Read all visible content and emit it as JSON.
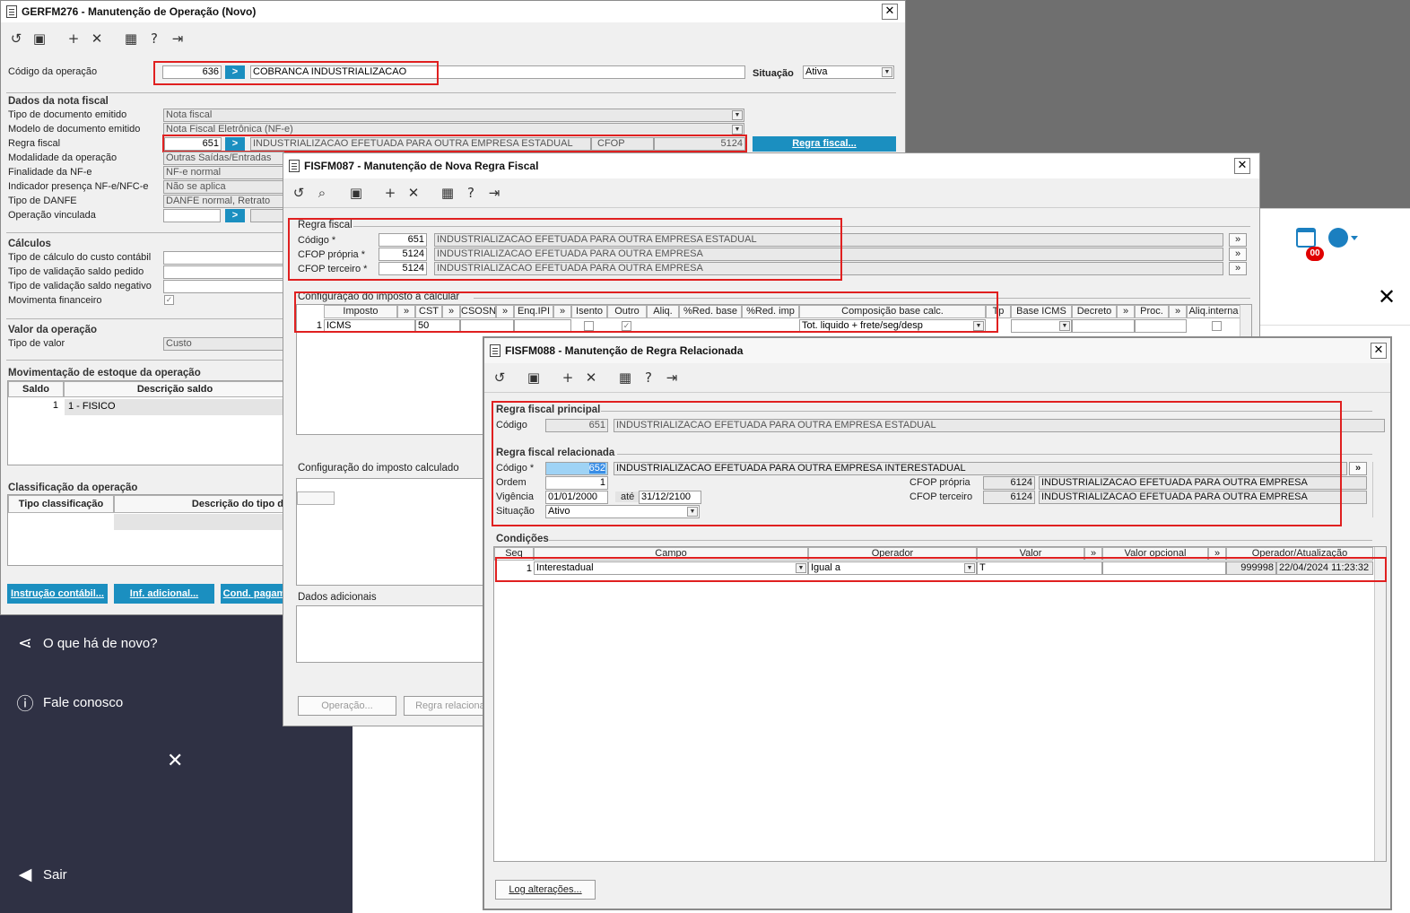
{
  "desktop": {
    "calendar_badge": "00"
  },
  "w1": {
    "title": "GERFM276 - Manutenção de Operação (Novo)",
    "codigo_label": "Código da operação",
    "codigo": "636",
    "descricao": "COBRANCA INDUSTRIALIZACAO",
    "situacao_label": "Situação",
    "situacao": "Ativa",
    "dados_label": "Dados da nota fiscal",
    "rows": [
      {
        "label": "Tipo de documento emitido",
        "value": "Nota fiscal"
      },
      {
        "label": "Modelo de documento emitido",
        "value": "Nota Fiscal Eletrônica (NF-e)"
      },
      {
        "label": "Regra fiscal",
        "value": ""
      },
      {
        "label": "Modalidade da operação",
        "value": "Outras Saídas/Entradas"
      },
      {
        "label": "Finalidade da NF-e",
        "value": "NF-e normal"
      },
      {
        "label": "Indicador presença NF-e/NFC-e",
        "value": "Não se aplica"
      },
      {
        "label": "Tipo de DANFE",
        "value": "DANFE normal, Retrato"
      },
      {
        "label": "Operação vinculada",
        "value": ""
      }
    ],
    "regra_codigo": "651",
    "regra_desc": "INDUSTRIALIZACAO EFETUADA PARA OUTRA EMPRESA ESTADUAL",
    "cfop_label": "CFOP",
    "cfop": "5124",
    "regra_btn": "Regra fiscal...",
    "calculos_label": "Cálculos",
    "calc_rows": [
      "Tipo de cálculo do custo contábil",
      "Tipo de validação saldo pedido",
      "Tipo de validação saldo negativo",
      "Movimenta financeiro"
    ],
    "valor_label": "Valor da operação",
    "tipo_valor_label": "Tipo de valor",
    "tipo_valor": "Custo",
    "mov_label": "Movimentação de estoque da operação",
    "saldo_h": "Saldo",
    "desc_saldo_h": "Descrição saldo",
    "saldo_n": "1",
    "saldo_d": "1 - FISICO",
    "class_label": "Classificação da operação",
    "tipo_class_h": "Tipo classificação",
    "desc_tipo_h": "Descrição do tipo d",
    "btn1": "Instrução contábil...",
    "btn2": "Inf. adicional...",
    "btn3": "Cond. pagam"
  },
  "sidebar": {
    "items": [
      {
        "icon": "share-icon",
        "label": "O que há de novo?"
      },
      {
        "icon": "help-icon",
        "label": "Fale conosco"
      }
    ],
    "exit": "Sair"
  },
  "w2": {
    "title": "FISFM087 - Manutenção de Nova Regra Fiscal",
    "regra_label": "Regra fiscal",
    "rows": [
      {
        "label": "Código *",
        "num": "651",
        "desc": "INDUSTRIALIZACAO EFETUADA PARA OUTRA EMPRESA ESTADUAL"
      },
      {
        "label": "CFOP própria *",
        "num": "5124",
        "desc": "INDUSTRIALIZACAO EFETUADA PARA OUTRA EMPRESA"
      },
      {
        "label": "CFOP terceiro *",
        "num": "5124",
        "desc": "INDUSTRIALIZACAO EFETUADA PARA OUTRA EMPRESA"
      }
    ],
    "config_label": "Configuração do imposto a calcular",
    "cols": [
      "Imposto",
      "»",
      "CST",
      "»",
      "CSOSN",
      "»",
      "Enq.IPI",
      "»",
      "Isento",
      "Outro",
      "Aliq.",
      "%Red. base",
      "%Red. imp",
      "Composição base calc.",
      "Tp",
      "Base ICMS",
      "Decreto",
      "»",
      "Proc.",
      "»",
      "Aliq.interna"
    ],
    "row": {
      "n": "1",
      "imposto": "ICMS",
      "cst": "50",
      "comp": "Tot. liquido + frete/seg/desp"
    },
    "calc_label": "Configuração do imposto calculado",
    "dados_label": "Dados adicionais",
    "btn1": "Operação...",
    "btn2": "Regra relacionad"
  },
  "w3": {
    "title": "FISFM088 - Manutenção de Regra Relacionada",
    "principal_label": "Regra fiscal principal",
    "cod_label": "Código",
    "principal_cod": "651",
    "principal_desc": "INDUSTRIALIZACAO EFETUADA PARA OUTRA EMPRESA ESTADUAL",
    "rel_label": "Regra fiscal relacionada",
    "rel_cod_label": "Código *",
    "rel_cod": "652",
    "rel_desc": "INDUSTRIALIZACAO EFETUADA PARA OUTRA EMPRESA INTERESTADUAL",
    "ordem_label": "Ordem",
    "ordem": "1",
    "vig_label": "Vigência",
    "vig_ini": "01/01/2000",
    "ate": "até",
    "vig_fim": "31/12/2100",
    "sit_label": "Situação",
    "sit": "Ativo",
    "cfop_p_label": "CFOP própria",
    "cfop_p": "6124",
    "cfop_p_desc": "INDUSTRIALIZACAO EFETUADA PARA OUTRA EMPRESA",
    "cfop_t_label": "CFOP terceiro",
    "cfop_t": "6124",
    "cfop_t_desc": "INDUSTRIALIZACAO EFETUADA PARA OUTRA EMPRESA",
    "cond_label": "Condições",
    "cols": [
      "Seq",
      "Campo",
      "Operador",
      "Valor",
      "»",
      "Valor opcional",
      "»",
      "Operador/Atualização"
    ],
    "row": {
      "seq": "1",
      "campo": "Interestadual",
      "operador": "Igual a",
      "valor": "T",
      "user": "999998",
      "dt": "22/04/2024 11:23:32"
    },
    "log_btn": "Log alterações..."
  }
}
